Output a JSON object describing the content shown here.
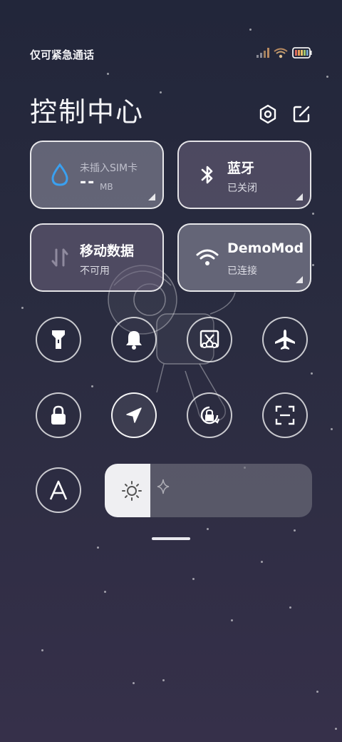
{
  "status_bar": {
    "carrier": "仅可紧急通话",
    "icons": [
      "signal-icon",
      "wifi-icon",
      "battery-icon"
    ]
  },
  "header": {
    "title": "控制中心",
    "settings_icon": "settings-hexagon-icon",
    "edit_icon": "edit-icon"
  },
  "tiles": {
    "data_usage": {
      "label": "未插入SIM卡",
      "value": "--",
      "unit": "MB",
      "icon": "water-drop-icon"
    },
    "bluetooth": {
      "title": "蓝牙",
      "status": "已关闭",
      "icon": "bluetooth-icon"
    },
    "mobile_data": {
      "title": "移动数据",
      "status": "不可用",
      "icon": "data-arrows-icon"
    },
    "wifi": {
      "title": "DemoMode",
      "status": "已连接",
      "icon": "wifi-icon"
    }
  },
  "toggles": [
    {
      "name": "flashlight",
      "icon": "flashlight-icon",
      "active": false
    },
    {
      "name": "ringer",
      "icon": "bell-icon",
      "active": false
    },
    {
      "name": "screenshot",
      "icon": "scissors-screenshot-icon",
      "active": false
    },
    {
      "name": "airplane",
      "icon": "airplane-icon",
      "active": false
    },
    {
      "name": "lock-screen",
      "icon": "lock-icon",
      "active": false
    },
    {
      "name": "location",
      "icon": "location-arrow-icon",
      "active": true
    },
    {
      "name": "rotation-lock",
      "icon": "rotation-lock-icon",
      "active": false
    },
    {
      "name": "scanner",
      "icon": "scan-icon",
      "active": false
    },
    {
      "name": "auto-brightness",
      "icon": "letter-a-icon",
      "active": false
    }
  ],
  "brightness": {
    "level": 0.22,
    "icon": "sun-icon",
    "auto_icon": "sparkle-icon"
  },
  "colors": {
    "background_top": "#22263a",
    "background_bottom": "#36304a",
    "accent": "#3aa0f0"
  }
}
